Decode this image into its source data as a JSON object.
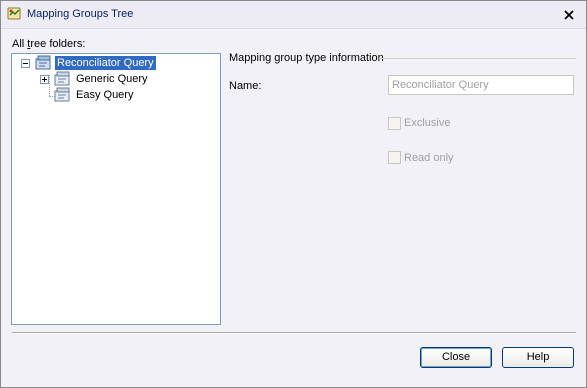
{
  "window": {
    "title": "Mapping Groups Tree"
  },
  "tree": {
    "label_prefix": "All",
    "label_underlined": "t",
    "label_rest": "ree folders:",
    "items": [
      {
        "label": "Reconciliator Query",
        "expander": "minus",
        "selected": true
      },
      {
        "label": "Generic Query",
        "expander": "plus",
        "selected": false
      },
      {
        "label": "Easy Query",
        "expander": "none",
        "selected": false
      }
    ]
  },
  "info": {
    "group_title": "Mapping group type information",
    "name_label": "Name:",
    "name_value": "Reconciliator Query",
    "exclusive_label": "Exclusive",
    "exclusive_checked": false,
    "readonly_label": "Read only",
    "readonly_checked": false
  },
  "buttons": {
    "close_label": "Close",
    "help_label": "Help"
  },
  "colors": {
    "title_text": "#0a246a",
    "selection": "#316ac5",
    "disabled_text": "#a0a0a0",
    "dialog_bg": "#f2f1f8"
  }
}
